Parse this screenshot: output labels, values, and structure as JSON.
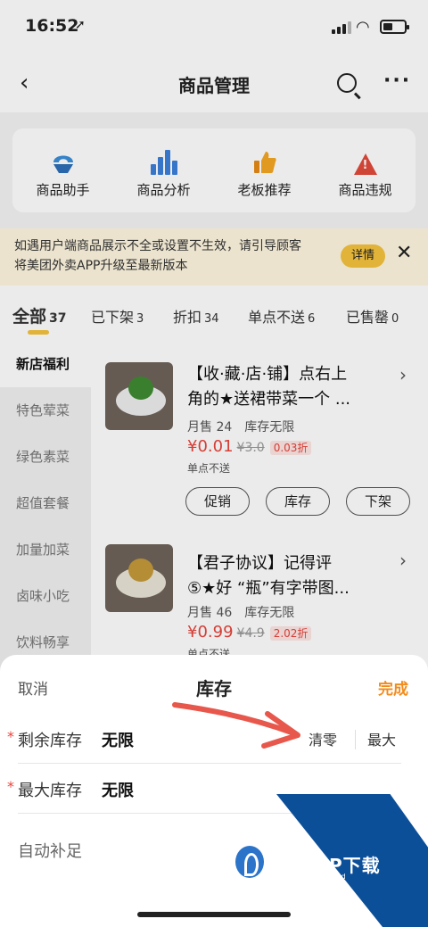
{
  "status": {
    "time": "16:52",
    "location_icon": "location-arrow-icon"
  },
  "nav": {
    "title": "商品管理"
  },
  "tools": [
    {
      "label": "商品助手",
      "icon": "assistant-icon"
    },
    {
      "label": "商品分析",
      "icon": "bar-chart-icon"
    },
    {
      "label": "老板推荐",
      "icon": "thumbs-up-icon"
    },
    {
      "label": "商品违规",
      "icon": "warning-icon"
    }
  ],
  "notice": {
    "line1": "如遇用户端商品展示不全或设置不生效，请引导顾客",
    "line2": "将美团外卖APP升级至最新版本",
    "detail_label": "详情"
  },
  "tabs": [
    {
      "label": "全部",
      "count": "37"
    },
    {
      "label": "已下架",
      "count": "3"
    },
    {
      "label": "折扣",
      "count": "34"
    },
    {
      "label": "单点不送",
      "count": "6"
    },
    {
      "label": "已售罄",
      "count": "0"
    }
  ],
  "categories": [
    "新店福利",
    "特色荤菜",
    "绿色素菜",
    "超值套餐",
    "加量加菜",
    "卤味小吃",
    "饮料畅享"
  ],
  "products": [
    {
      "title_line1": "【收·藏·店·铺】点右上",
      "title_line2": "角的★送裙带菜一个 ...",
      "sales": "月售 24",
      "stock": "库存无限",
      "price": "¥0.01",
      "old_price": "¥3.0",
      "discount": "0.03折",
      "tag": "单点不送",
      "buttons": [
        "促销",
        "库存",
        "下架"
      ]
    },
    {
      "title_line1": "【君子协议】记得评",
      "title_line2": "⑤★好 “瓶”有字带图...",
      "sales": "月售 46",
      "stock": "库存无限",
      "price": "¥0.99",
      "old_price": "¥4.9",
      "discount": "2.02折",
      "tag": "单点不送"
    }
  ],
  "sheet": {
    "cancel": "取消",
    "title": "库存",
    "done": "完成",
    "remaining_label": "剩余库存",
    "remaining_value": "无限",
    "clear_label": "清零",
    "max_label": "最大",
    "max_stock_label": "最大库存",
    "max_stock_value": "无限",
    "auto_label": "自动补足"
  },
  "watermark": {
    "word": "PCPOP下载",
    "sub": "PCPOP Download"
  },
  "colors": {
    "accent": "#f28c1c",
    "price": "#e8453c",
    "tab_indicator": "#f5c33d",
    "watermark": "#0c4f99"
  }
}
